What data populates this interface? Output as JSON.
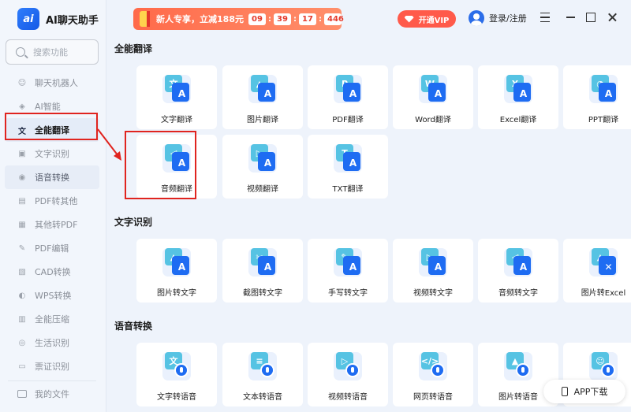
{
  "app": {
    "title": "AI聊天助手",
    "logo_text": "ai"
  },
  "search": {
    "placeholder": "搜索功能"
  },
  "sidebar": {
    "items": [
      {
        "label": "聊天机器人",
        "icon": "robot-icon",
        "glyph": "☺"
      },
      {
        "label": "AI智能",
        "icon": "ai-icon",
        "glyph": "◈"
      },
      {
        "label": "全能翻译",
        "icon": "translate-icon",
        "glyph": "文"
      },
      {
        "label": "文字识别",
        "icon": "text-scan-icon",
        "glyph": "▣"
      },
      {
        "label": "语音转换",
        "icon": "voice-icon",
        "glyph": "◉"
      },
      {
        "label": "PDF转其他",
        "icon": "pdf-icon",
        "glyph": "▤"
      },
      {
        "label": "其他转PDF",
        "icon": "pdf-convert-icon",
        "glyph": "▦"
      },
      {
        "label": "PDF编辑",
        "icon": "pdf-edit-icon",
        "glyph": "✎"
      },
      {
        "label": "CAD转换",
        "icon": "cad-icon",
        "glyph": "▧"
      },
      {
        "label": "WPS转换",
        "icon": "wps-icon",
        "glyph": "◐"
      },
      {
        "label": "全能压缩",
        "icon": "compress-icon",
        "glyph": "▥"
      },
      {
        "label": "生活识别",
        "icon": "life-scan-icon",
        "glyph": "◎"
      },
      {
        "label": "票证识别",
        "icon": "ticket-icon",
        "glyph": "▭"
      }
    ],
    "active_index": 2,
    "my_files": "我的文件"
  },
  "promo": {
    "text": "新人专享，立减188元",
    "timer": {
      "h": "09",
      "m": "39",
      "s": "17",
      "ms": "446"
    }
  },
  "header": {
    "vip_label": "开通VIP",
    "login_label": "登录/注册"
  },
  "sections": [
    {
      "title": "全能翻译",
      "cards": [
        {
          "label": "文字翻译",
          "a": "文",
          "b": "A"
        },
        {
          "label": "图片翻译",
          "a": "▲",
          "b": "A"
        },
        {
          "label": "PDF翻译",
          "a": "P",
          "b": "A"
        },
        {
          "label": "Word翻译",
          "a": "W",
          "b": "A"
        },
        {
          "label": "Excel翻译",
          "a": "X",
          "b": "A"
        },
        {
          "label": "PPT翻译",
          "a": "◔",
          "b": "A"
        },
        {
          "label": "音频翻译",
          "a": "◁",
          "b": "A"
        },
        {
          "label": "视频翻译",
          "a": "▷",
          "b": "A"
        },
        {
          "label": "TXT翻译",
          "a": "T",
          "b": "A"
        }
      ]
    },
    {
      "title": "文字识别",
      "cards": [
        {
          "label": "图片转文字",
          "a": "▲",
          "b": "A"
        },
        {
          "label": "截图转文字",
          "a": "✂",
          "b": "A"
        },
        {
          "label": "手写转文字",
          "a": "✎",
          "b": "A"
        },
        {
          "label": "视频转文字",
          "a": "▷",
          "b": "A"
        },
        {
          "label": "音频转文字",
          "a": "◁",
          "b": "A"
        },
        {
          "label": "图片转Excel",
          "a": "▲",
          "b": "✕"
        }
      ]
    },
    {
      "title": "语音转换",
      "cards": [
        {
          "label": "文字转语音",
          "a": "文",
          "b": ""
        },
        {
          "label": "文本转语音",
          "a": "≡",
          "b": ""
        },
        {
          "label": "视频转语音",
          "a": "▷",
          "b": ""
        },
        {
          "label": "网页转语音",
          "a": "</>",
          "b": ""
        },
        {
          "label": "图片转语音",
          "a": "▲",
          "b": ""
        },
        {
          "label": "",
          "a": "☺",
          "b": ""
        }
      ]
    }
  ],
  "app_download": "APP下载",
  "colors": {
    "accent": "#1e6cf2",
    "highlight": "#e0241f",
    "promo": "#ff6a4a"
  }
}
